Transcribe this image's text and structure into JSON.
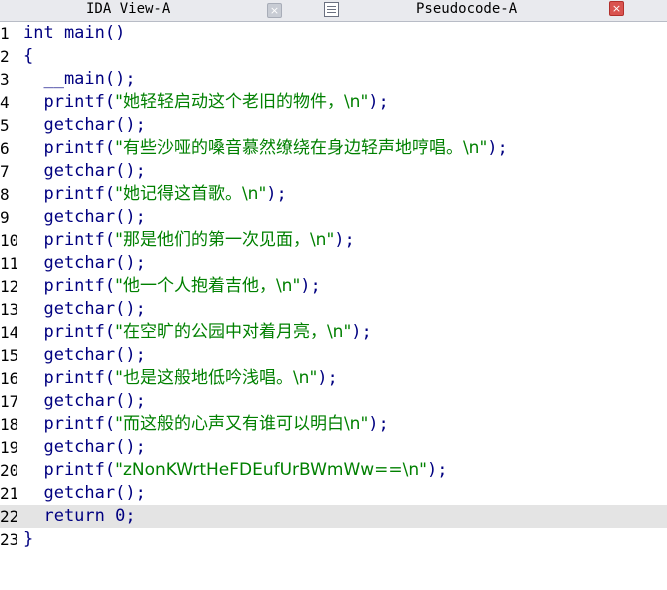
{
  "tabs": [
    {
      "label": "IDA View-A",
      "close_icon": "close-icon-inactive"
    },
    {
      "label": "Pseudocode-A",
      "icon": "pseudocode-icon",
      "close_icon": "close-icon-active"
    }
  ],
  "code_lines": [
    {
      "num": "1",
      "pre": "int main()",
      "str": "",
      "post": ""
    },
    {
      "num": "2",
      "pre": "{",
      "str": "",
      "post": ""
    },
    {
      "num": "3",
      "pre": "  __main();",
      "str": "",
      "post": ""
    },
    {
      "num": "4",
      "pre": "  printf(",
      "str": "\"她轻轻启动这个老旧的物件，\\n\"",
      "post": ");"
    },
    {
      "num": "5",
      "pre": "  getchar();",
      "str": "",
      "post": ""
    },
    {
      "num": "6",
      "pre": "  printf(",
      "str": "\"有些沙哑的嗓音慕然缭绕在身边轻声地哼唱。\\n\"",
      "post": ");"
    },
    {
      "num": "7",
      "pre": "  getchar();",
      "str": "",
      "post": ""
    },
    {
      "num": "8",
      "pre": "  printf(",
      "str": "\"她记得这首歌。\\n\"",
      "post": ");"
    },
    {
      "num": "9",
      "pre": "  getchar();",
      "str": "",
      "post": ""
    },
    {
      "num": "10",
      "pre": "  printf(",
      "str": "\"那是他们的第一次见面，\\n\"",
      "post": ");"
    },
    {
      "num": "11",
      "pre": "  getchar();",
      "str": "",
      "post": ""
    },
    {
      "num": "12",
      "pre": "  printf(",
      "str": "\"他一个人抱着吉他，\\n\"",
      "post": ");"
    },
    {
      "num": "13",
      "pre": "  getchar();",
      "str": "",
      "post": ""
    },
    {
      "num": "14",
      "pre": "  printf(",
      "str": "\"在空旷的公园中对着月亮，\\n\"",
      "post": ");"
    },
    {
      "num": "15",
      "pre": "  getchar();",
      "str": "",
      "post": ""
    },
    {
      "num": "16",
      "pre": "  printf(",
      "str": "\"也是这般地低吟浅唱。\\n\"",
      "post": ");"
    },
    {
      "num": "17",
      "pre": "  getchar();",
      "str": "",
      "post": ""
    },
    {
      "num": "18",
      "pre": "  printf(",
      "str": "\"而这般的心声又有谁可以明白\\n\"",
      "post": ");"
    },
    {
      "num": "19",
      "pre": "  getchar();",
      "str": "",
      "post": ""
    },
    {
      "num": "20",
      "pre": "  printf(",
      "str": "\"zNonKWrtHeFDEufUrBWmWw==\\n\"",
      "post": ");"
    },
    {
      "num": "21",
      "pre": "  getchar();",
      "str": "",
      "post": ""
    },
    {
      "num": "22",
      "pre": "  return 0;",
      "str": "",
      "post": "",
      "current": true
    },
    {
      "num": "23",
      "pre": "}",
      "str": "",
      "post": ""
    }
  ],
  "colors": {
    "code": "#000080",
    "string": "#008000",
    "current_line": "#e4e4e4"
  }
}
